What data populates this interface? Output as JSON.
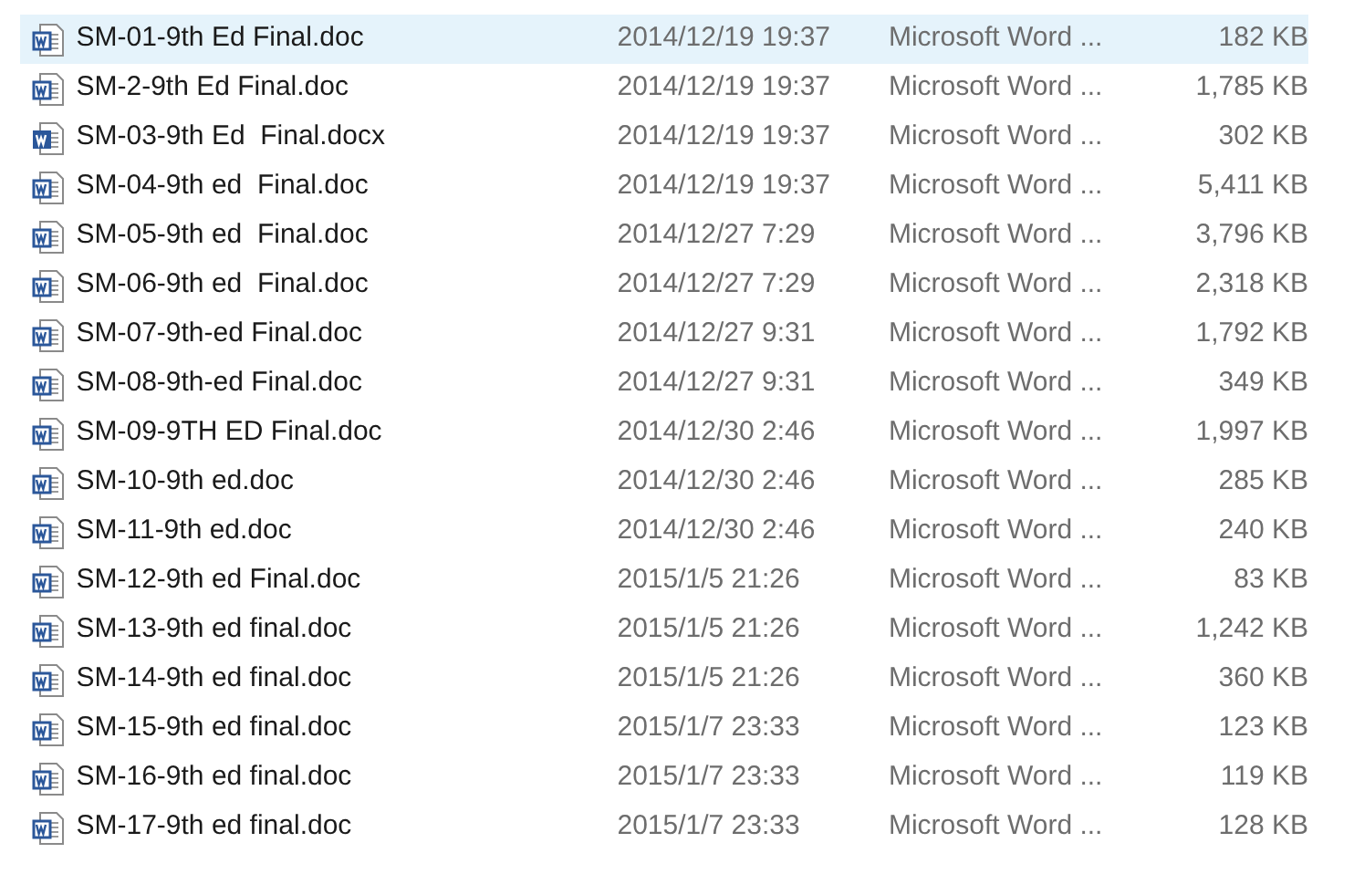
{
  "files": [
    {
      "name": "SM-01-9th Ed Final.doc",
      "kind": "doc",
      "date": "2014/12/19 19:37",
      "type": "Microsoft Word ...",
      "size": "182 KB",
      "selected": true
    },
    {
      "name": "SM-2-9th Ed Final.doc",
      "kind": "doc",
      "date": "2014/12/19 19:37",
      "type": "Microsoft Word ...",
      "size": "1,785 KB",
      "selected": false
    },
    {
      "name": "SM-03-9th Ed  Final.docx",
      "kind": "docx",
      "date": "2014/12/19 19:37",
      "type": "Microsoft Word ...",
      "size": "302 KB",
      "selected": false
    },
    {
      "name": "SM-04-9th ed  Final.doc",
      "kind": "doc",
      "date": "2014/12/19 19:37",
      "type": "Microsoft Word ...",
      "size": "5,411 KB",
      "selected": false
    },
    {
      "name": "SM-05-9th ed  Final.doc",
      "kind": "doc",
      "date": "2014/12/27 7:29",
      "type": "Microsoft Word ...",
      "size": "3,796 KB",
      "selected": false
    },
    {
      "name": "SM-06-9th ed  Final.doc",
      "kind": "doc",
      "date": "2014/12/27 7:29",
      "type": "Microsoft Word ...",
      "size": "2,318 KB",
      "selected": false
    },
    {
      "name": "SM-07-9th-ed Final.doc",
      "kind": "doc",
      "date": "2014/12/27 9:31",
      "type": "Microsoft Word ...",
      "size": "1,792 KB",
      "selected": false
    },
    {
      "name": "SM-08-9th-ed Final.doc",
      "kind": "doc",
      "date": "2014/12/27 9:31",
      "type": "Microsoft Word ...",
      "size": "349 KB",
      "selected": false
    },
    {
      "name": "SM-09-9TH ED Final.doc",
      "kind": "doc",
      "date": "2014/12/30 2:46",
      "type": "Microsoft Word ...",
      "size": "1,997 KB",
      "selected": false
    },
    {
      "name": "SM-10-9th ed.doc",
      "kind": "doc",
      "date": "2014/12/30 2:46",
      "type": "Microsoft Word ...",
      "size": "285 KB",
      "selected": false
    },
    {
      "name": "SM-11-9th ed.doc",
      "kind": "doc",
      "date": "2014/12/30 2:46",
      "type": "Microsoft Word ...",
      "size": "240 KB",
      "selected": false
    },
    {
      "name": "SM-12-9th ed Final.doc",
      "kind": "doc",
      "date": "2015/1/5 21:26",
      "type": "Microsoft Word ...",
      "size": "83 KB",
      "selected": false
    },
    {
      "name": "SM-13-9th ed final.doc",
      "kind": "doc",
      "date": "2015/1/5 21:26",
      "type": "Microsoft Word ...",
      "size": "1,242 KB",
      "selected": false
    },
    {
      "name": "SM-14-9th ed final.doc",
      "kind": "doc",
      "date": "2015/1/5 21:26",
      "type": "Microsoft Word ...",
      "size": "360 KB",
      "selected": false
    },
    {
      "name": "SM-15-9th ed final.doc",
      "kind": "doc",
      "date": "2015/1/7 23:33",
      "type": "Microsoft Word ...",
      "size": "123 KB",
      "selected": false
    },
    {
      "name": "SM-16-9th ed final.doc",
      "kind": "doc",
      "date": "2015/1/7 23:33",
      "type": "Microsoft Word ...",
      "size": "119 KB",
      "selected": false
    },
    {
      "name": "SM-17-9th ed final.doc",
      "kind": "doc",
      "date": "2015/1/7 23:33",
      "type": "Microsoft Word ...",
      "size": "128 KB",
      "selected": false
    }
  ]
}
